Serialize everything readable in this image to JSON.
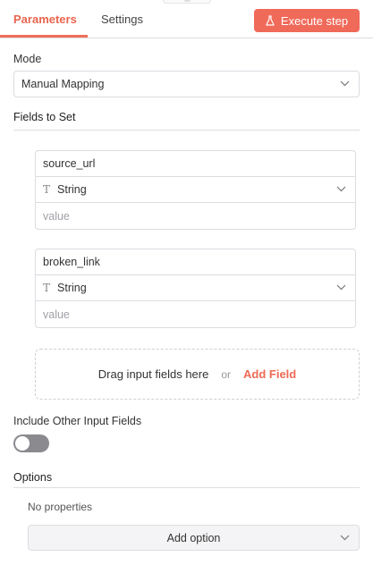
{
  "tabs": [
    {
      "label": "Parameters",
      "active": true
    },
    {
      "label": "Settings",
      "active": false
    }
  ],
  "execute_button": {
    "label": "Execute step",
    "icon": "flask-icon"
  },
  "mode": {
    "label": "Mode",
    "value": "Manual Mapping"
  },
  "fields_section": {
    "label": "Fields to Set"
  },
  "fields": [
    {
      "name": "source_url",
      "type": "String",
      "type_icon": "text-type-icon",
      "value_placeholder": "value"
    },
    {
      "name": "broken_link",
      "type": "String",
      "type_icon": "text-type-icon",
      "value_placeholder": "value"
    }
  ],
  "dropzone": {
    "text": "Drag input fields here",
    "or": "or",
    "add_field": "Add Field"
  },
  "include_other": {
    "label": "Include Other Input Fields",
    "enabled": false
  },
  "options": {
    "label": "Options",
    "empty_text": "No properties",
    "add_option": "Add option"
  },
  "colors": {
    "accent": "#f06a5a",
    "toggle_off": "#8a8a8f",
    "border": "#dcdce2"
  }
}
